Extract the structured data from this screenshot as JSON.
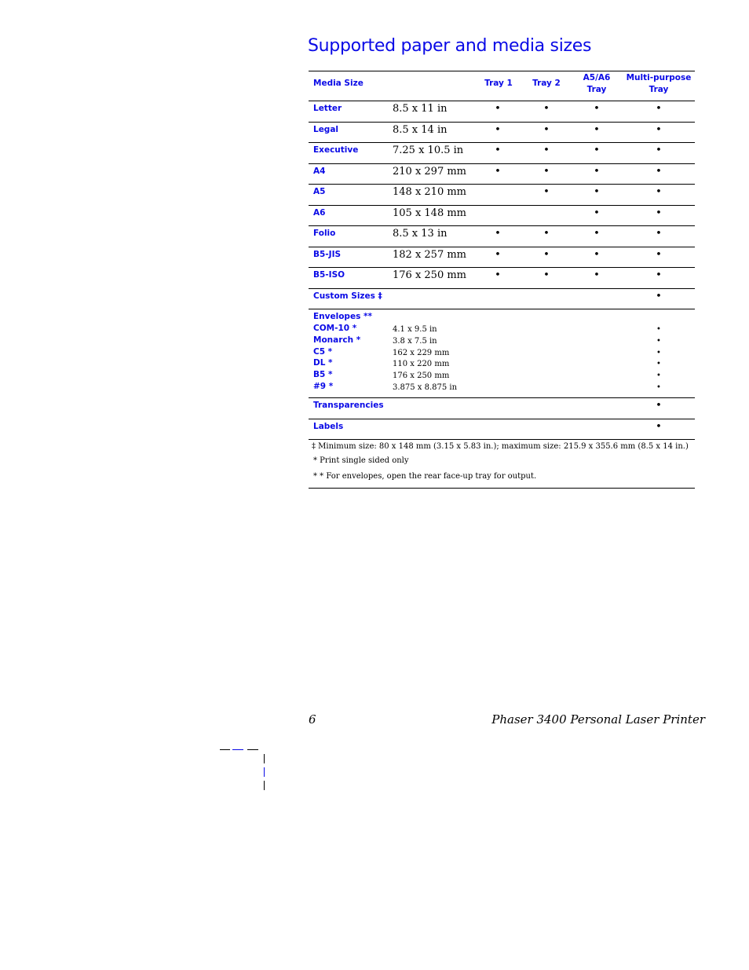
{
  "page": {
    "title": "Supported paper and media sizes",
    "page_number": "6",
    "footer_title": "Phaser 3400 Personal Laser Printer"
  },
  "table": {
    "headers": {
      "media_size": "Media Size",
      "tray1": "Tray 1",
      "tray2": "Tray 2",
      "a5a6_line1": "A5/A6",
      "a5a6_line2": "Tray",
      "mp_line1": "Multi-purpose",
      "mp_line2": "Tray"
    },
    "bullet": "•",
    "rows": [
      {
        "name": "Letter",
        "size": "8.5 x 11 in",
        "tray1": "•",
        "tray2": "•",
        "a5a6": "•",
        "mp": "•"
      },
      {
        "name": "Legal",
        "size": "8.5 x 14 in",
        "tray1": "•",
        "tray2": "•",
        "a5a6": "•",
        "mp": "•"
      },
      {
        "name": "Executive",
        "size": "7.25 x 10.5 in",
        "tray1": "•",
        "tray2": "•",
        "a5a6": "•",
        "mp": "•"
      },
      {
        "name": "A4",
        "size": "210 x 297 mm",
        "tray1": "•",
        "tray2": "•",
        "a5a6": "•",
        "mp": "•"
      },
      {
        "name": "A5",
        "size": "148 x 210 mm",
        "tray1": "",
        "tray2": "•",
        "a5a6": "•",
        "mp": "•"
      },
      {
        "name": "A6",
        "size": "105 x 148 mm",
        "tray1": "",
        "tray2": "",
        "a5a6": "•",
        "mp": "•"
      },
      {
        "name": "Folio",
        "size": "8.5 x 13 in",
        "tray1": "•",
        "tray2": "•",
        "a5a6": "•",
        "mp": "•"
      },
      {
        "name": "B5-JIS",
        "size": "182 x 257 mm",
        "tray1": "•",
        "tray2": "•",
        "a5a6": "•",
        "mp": "•"
      },
      {
        "name": "B5-ISO",
        "size": "176 x 250 mm",
        "tray1": "•",
        "tray2": "•",
        "a5a6": "•",
        "mp": "•"
      },
      {
        "name": "Custom Sizes ‡",
        "size": "",
        "tray1": "",
        "tray2": "",
        "a5a6": "",
        "mp": "•"
      }
    ],
    "envelopes": {
      "heading": "Envelopes **",
      "items": [
        {
          "name": "COM-10 *",
          "size": "4.1 x 9.5 in",
          "mp": "•"
        },
        {
          "name": "Monarch *",
          "size": "3.8 x 7.5 in",
          "mp": "•"
        },
        {
          "name": "C5  *",
          "size": "162 x 229 mm",
          "mp": "•"
        },
        {
          "name": "DL *",
          "size": "110 x 220 mm",
          "mp": "•"
        },
        {
          "name": "B5 *",
          "size": "176 x 250 mm",
          "mp": "•"
        },
        {
          "name": "#9 *",
          "size": "3.875 x 8.875 in",
          "mp": "•"
        }
      ]
    },
    "extra_rows": [
      {
        "name": "Transparencies",
        "mp": "•"
      },
      {
        "name": "Labels",
        "mp": "•"
      }
    ],
    "notes": [
      "‡ Minimum size: 80 x 148 mm (3.15 x 5.83 in.); maximum size: 215.9 x 355.6 mm (8.5 x 14 in.)",
      "*  Print single sided only",
      "* *  For envelopes, open the rear face-up tray for output."
    ]
  }
}
